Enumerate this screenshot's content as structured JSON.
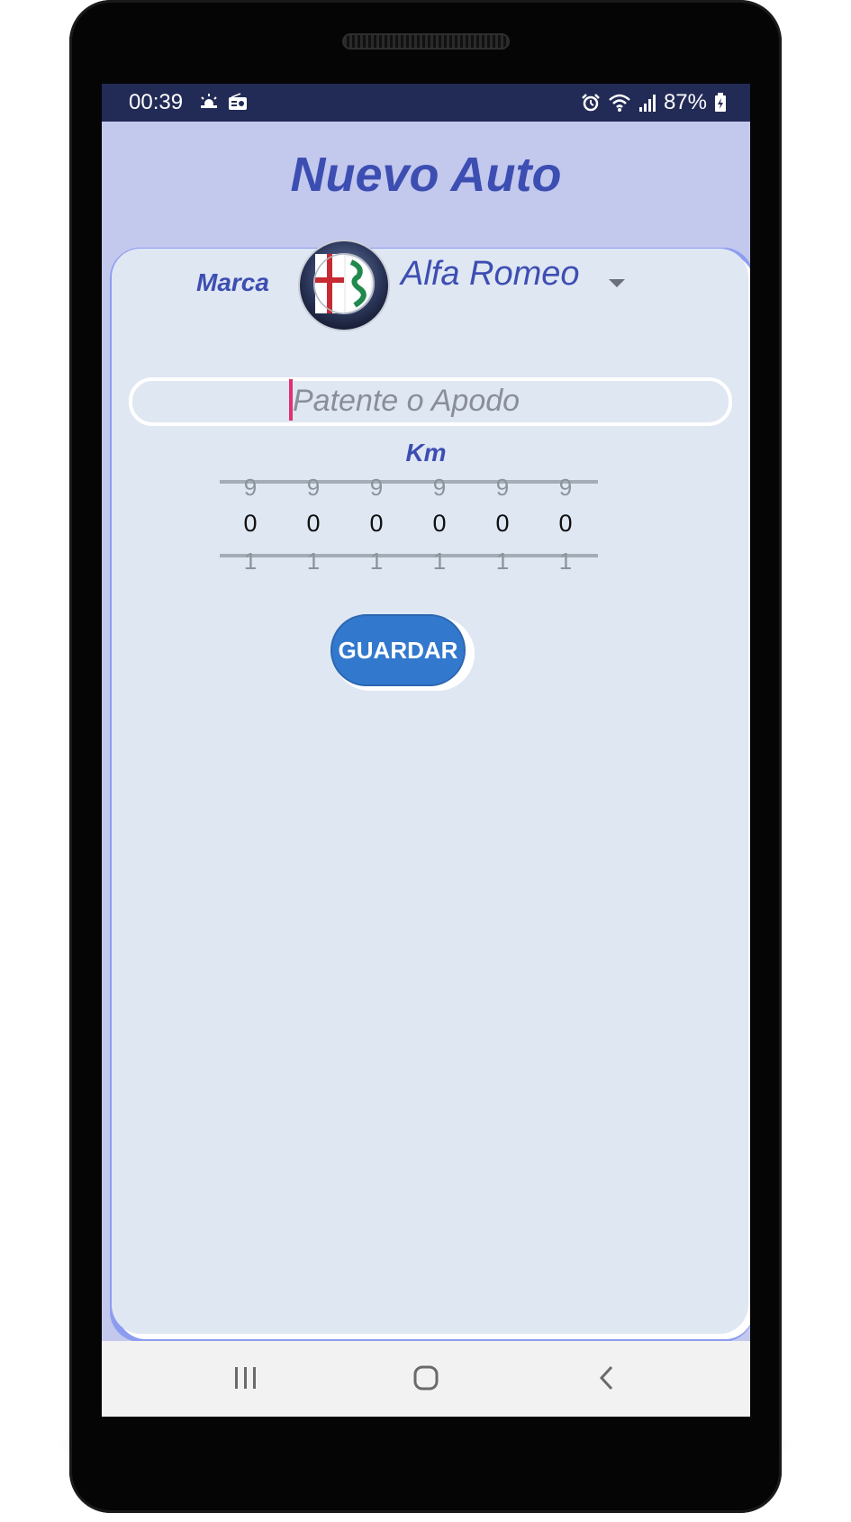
{
  "status_bar": {
    "time": "00:39",
    "battery": "87%",
    "left_icons": [
      "weather-icon",
      "radio-icon"
    ],
    "right_icons": [
      "alarm-icon",
      "wifi-icon",
      "signal-icon",
      "battery-charging-icon"
    ]
  },
  "header": {
    "title": "Nuevo Auto"
  },
  "form": {
    "brand_label": "Marca",
    "brand_selected": "Alfa Romeo",
    "brand_logo_icon": "alfa-romeo-logo",
    "plate_placeholder": "Patente o Apodo",
    "plate_value": "",
    "km_label": "Km",
    "km_digits": [
      {
        "prev": "9",
        "current": "0",
        "next": "1"
      },
      {
        "prev": "9",
        "current": "0",
        "next": "1"
      },
      {
        "prev": "9",
        "current": "0",
        "next": "1"
      },
      {
        "prev": "9",
        "current": "0",
        "next": "1"
      },
      {
        "prev": "9",
        "current": "0",
        "next": "1"
      },
      {
        "prev": "9",
        "current": "0",
        "next": "1"
      }
    ],
    "save_label": "GUARDAR"
  },
  "nav_bar": {
    "icons": [
      "recent-apps-icon",
      "home-icon",
      "back-icon"
    ]
  },
  "colors": {
    "accent": "#3d4eb2",
    "background": "#c3c8ed",
    "card": "#dfe7f3",
    "button": "#3279cd",
    "status_bar": "#222a56",
    "cursor": "#e0306e"
  }
}
